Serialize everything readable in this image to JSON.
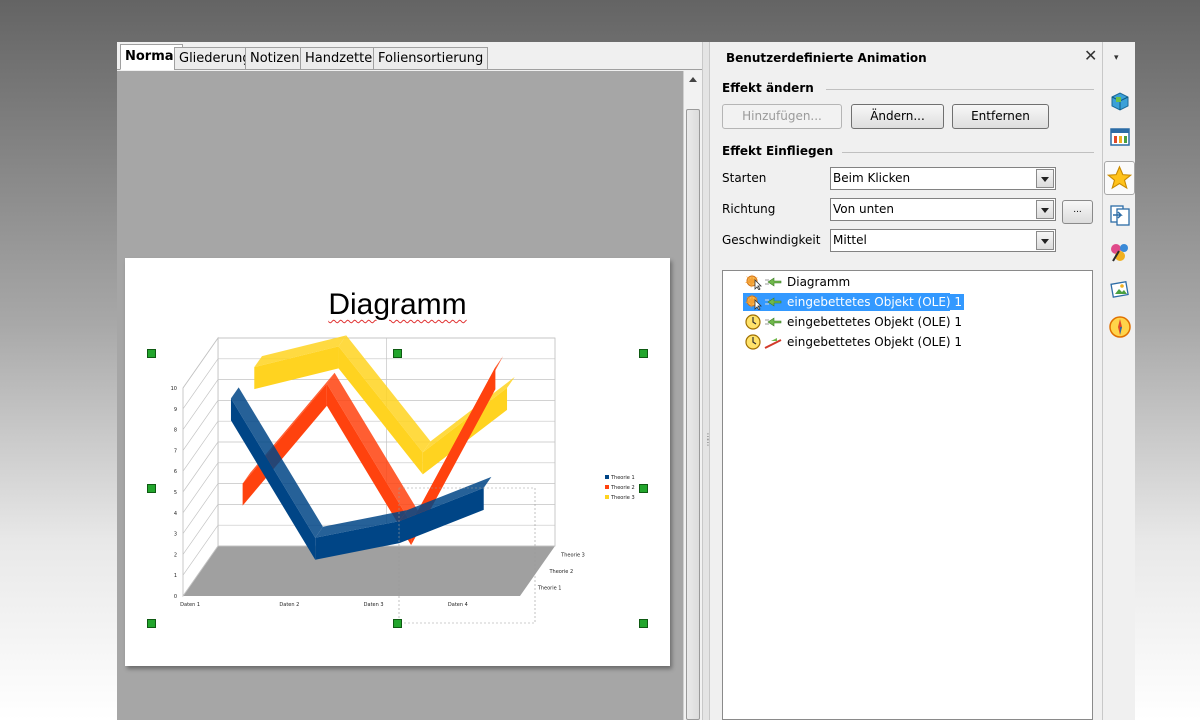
{
  "tabs": [
    {
      "label": "Normal",
      "active": true
    },
    {
      "label": "Gliederung"
    },
    {
      "label": "Notizen"
    },
    {
      "label": "Handzettel"
    },
    {
      "label": "Foliensortierung"
    }
  ],
  "slide": {
    "title": "Diagramm"
  },
  "chart_data": {
    "type": "line",
    "style": "3d-ribbon",
    "categories": [
      "Daten 1",
      "Daten 2",
      "Daten 3",
      "Daten 4"
    ],
    "series": [
      {
        "name": "Theorie 1",
        "color": "#004586",
        "values": [
          9.1,
          2.4,
          3.2,
          4.8
        ]
      },
      {
        "name": "Theorie 2",
        "color": "#ff420e",
        "values": [
          4.2,
          9.0,
          2.3,
          9.8
        ]
      },
      {
        "name": "Theorie 3",
        "color": "#ffd320",
        "values": [
          9.0,
          10.0,
          4.9,
          8.0
        ]
      }
    ],
    "ylim": [
      0,
      10
    ],
    "yticks": [
      0,
      1,
      2,
      3,
      4,
      5,
      6,
      7,
      8,
      9,
      10
    ],
    "depth_labels": [
      "Theorie 1",
      "Theorie 2",
      "Theorie 3"
    ],
    "legend_position": "right",
    "grid": true
  },
  "panel": {
    "title": "Benutzerdefinierte Animation",
    "close_icon": "close-icon",
    "section_change": "Effekt ändern",
    "add_label": "Hinzufügen...",
    "change_label": "Ändern...",
    "remove_label": "Entfernen",
    "section_effect": "Effekt Einfliegen",
    "start_label": "Starten",
    "start_value": "Beim Klicken",
    "direction_label": "Richtung",
    "direction_value": "Von unten",
    "more_label": "...",
    "speed_label": "Geschwindigkeit",
    "speed_value": "Mittel",
    "effects": [
      {
        "label": "Diagramm",
        "trigger": "click",
        "selected": false
      },
      {
        "label": "eingebettetes Objekt (OLE) 1",
        "trigger": "click",
        "selected": true
      },
      {
        "label": "eingebettetes Objekt (OLE) 1",
        "trigger": "time",
        "selected": false
      },
      {
        "label": "eingebettetes Objekt (OLE) 1",
        "trigger": "time",
        "selected": false
      }
    ]
  },
  "sidebar": {
    "items": [
      "properties-icon",
      "master-slides-icon",
      "custom-animation-icon",
      "slide-transition-icon",
      "styles-icon",
      "gallery-icon",
      "navigator-icon"
    ]
  }
}
